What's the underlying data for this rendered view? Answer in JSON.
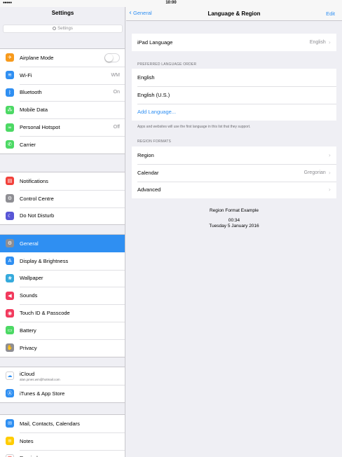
{
  "status_bar": {
    "time": "10:00",
    "signal": "●●●●●"
  },
  "left": {
    "title": "Settings",
    "search_placeholder": "Settings",
    "groups": [
      [
        {
          "label": "Airplane Mode",
          "icon": "airplane-icon",
          "color": "#f79a1c",
          "glyph": "✈",
          "toggle": true
        },
        {
          "label": "Wi-Fi",
          "icon": "wifi-icon",
          "color": "#2f8ff2",
          "glyph": "≋",
          "value": "WM"
        },
        {
          "label": "Bluetooth",
          "icon": "bluetooth-icon",
          "color": "#2f8ff2",
          "glyph": "ᛒ",
          "value": "On"
        },
        {
          "label": "Mobile Data",
          "icon": "antenna-icon",
          "color": "#4cd964",
          "glyph": "⁂"
        },
        {
          "label": "Personal Hotspot",
          "icon": "link-icon",
          "color": "#4cd964",
          "glyph": "∞",
          "value": "Off"
        },
        {
          "label": "Carrier",
          "icon": "phone-icon",
          "color": "#4cd964",
          "glyph": "✆"
        }
      ],
      [
        {
          "label": "Notifications",
          "icon": "notifications-icon",
          "color": "#f2413b",
          "glyph": "▤"
        },
        {
          "label": "Control Centre",
          "icon": "control-centre-icon",
          "color": "#8e8e93",
          "glyph": "⚙"
        },
        {
          "label": "Do Not Disturb",
          "icon": "moon-icon",
          "color": "#5856d6",
          "glyph": "☾"
        }
      ],
      [
        {
          "label": "General",
          "icon": "gear-icon",
          "color": "#8e8e93",
          "glyph": "⚙",
          "selected": true
        },
        {
          "label": "Display & Brightness",
          "icon": "display-icon",
          "color": "#2f8ff2",
          "glyph": "A"
        },
        {
          "label": "Wallpaper",
          "icon": "wallpaper-icon",
          "color": "#35aadc",
          "glyph": "❀"
        },
        {
          "label": "Sounds",
          "icon": "speaker-icon",
          "color": "#f23a5d",
          "glyph": "◀"
        },
        {
          "label": "Touch ID & Passcode",
          "icon": "fingerprint-icon",
          "color": "#f23a5d",
          "glyph": "◉"
        },
        {
          "label": "Battery",
          "icon": "battery-icon",
          "color": "#4cd964",
          "glyph": "▭"
        },
        {
          "label": "Privacy",
          "icon": "hand-icon",
          "color": "#8e8e93",
          "glyph": "✋"
        }
      ],
      [
        {
          "label": "iCloud",
          "sub": "alan.jones.wm@hotmail.com",
          "icon": "cloud-icon",
          "color": "#ffffff",
          "glyph": "☁",
          "glyph_color": "#2f8ff2"
        },
        {
          "label": "iTunes & App Store",
          "icon": "app-store-icon",
          "color": "#2f8ff2",
          "glyph": "Ⓐ"
        }
      ],
      [
        {
          "label": "Mail, Contacts, Calendars",
          "icon": "mail-icon",
          "color": "#2f8ff2",
          "glyph": "✉"
        },
        {
          "label": "Notes",
          "icon": "notes-icon",
          "color": "#ffcc00",
          "glyph": "≡"
        },
        {
          "label": "Reminders",
          "icon": "reminders-icon",
          "color": "#ffffff",
          "glyph": "☰",
          "glyph_color": "#f2413b"
        }
      ]
    ]
  },
  "right": {
    "back_label": "General",
    "title": "Language & Region",
    "edit_label": "Edit",
    "ipad_language": {
      "label": "iPad Language",
      "value": "English"
    },
    "preferred_header": "PREFERRED LANGUAGE ORDER",
    "languages": [
      "English",
      "English (U.S.)"
    ],
    "add_language": "Add Language...",
    "languages_footer": "Apps and websites will use the first language in this list that they support.",
    "region_header": "REGION FORMATS",
    "region_rows": [
      {
        "label": "Region",
        "value": ""
      },
      {
        "label": "Calendar",
        "value": "Gregorian"
      },
      {
        "label": "Advanced",
        "value": ""
      }
    ],
    "example": {
      "title": "Region Format Example",
      "time": "00:34",
      "date": "Tuesday 5 January 2016"
    }
  },
  "colors": {
    "accent": "#2f8ff2",
    "background": "#efeff4"
  }
}
